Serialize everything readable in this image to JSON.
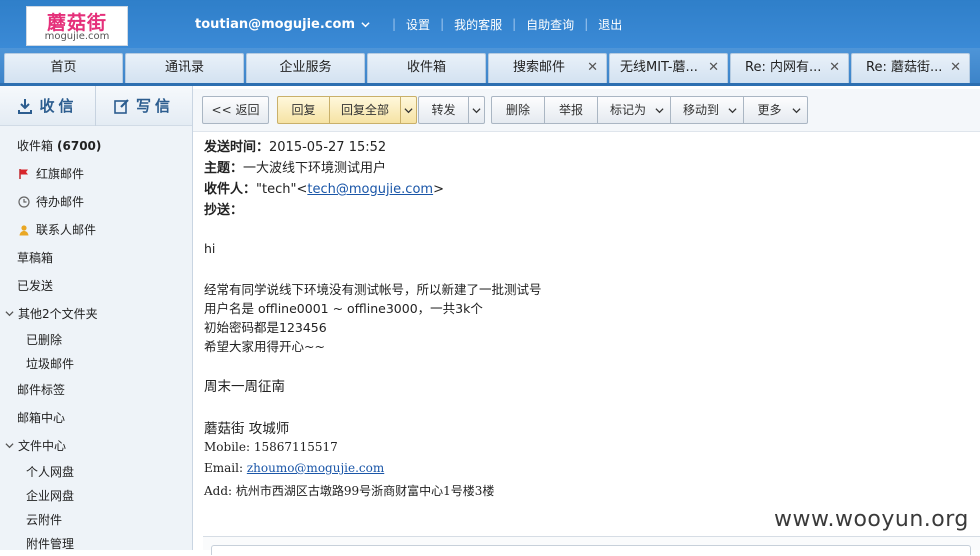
{
  "header": {
    "logo_text": "蘑菇街",
    "logo_sub": "mogujie.com",
    "user_email": "toutian@mogujie.com",
    "links": [
      "设置",
      "我的客服",
      "自助查询",
      "退出"
    ]
  },
  "tabs": [
    {
      "label": "首页"
    },
    {
      "label": "通讯录"
    },
    {
      "label": "企业服务"
    },
    {
      "label": "收件箱"
    },
    {
      "label": "搜索邮件"
    },
    {
      "label": "无线MIT-蘑..."
    },
    {
      "label": "Re: 内网有..."
    },
    {
      "label": "Re: 蘑菇街..."
    }
  ],
  "sidebar": {
    "receive_label": "收信",
    "write_label": "写信",
    "inbox_label": "收件箱",
    "inbox_count": "(6700)",
    "items": [
      {
        "label": "红旗邮件"
      },
      {
        "label": "待办邮件"
      },
      {
        "label": "联系人邮件"
      },
      {
        "label": "草稿箱"
      },
      {
        "label": "已发送"
      },
      {
        "label": "其他2个文件夹"
      },
      {
        "label": "已删除"
      },
      {
        "label": "垃圾邮件"
      },
      {
        "label": "邮件标签"
      },
      {
        "label": "邮箱中心"
      },
      {
        "label": "文件中心"
      },
      {
        "label": "个人网盘"
      },
      {
        "label": "企业网盘"
      },
      {
        "label": "云附件"
      },
      {
        "label": "附件管理"
      }
    ]
  },
  "toolbar": {
    "back": "返回",
    "reply": "回复",
    "reply_all": "回复全部",
    "forward": "转发",
    "delete": "删除",
    "report": "举报",
    "mark_as": "标记为",
    "move_to": "移动到",
    "more": "更多"
  },
  "mail": {
    "sent_label": "发送时间：",
    "sent_value": "2015-05-27 15:52",
    "subject_label": "主题：",
    "subject_value": "一大波线下环境测试用户",
    "to_label": "收件人：",
    "to_name": "\"tech\"<",
    "to_email": "tech@mogujie.com",
    "to_end": ">",
    "cc_label": "抄送：",
    "body": [
      "hi",
      "经常有同学说线下环境没有测试帐号，所以新建了一批测试号",
      "用户名是 offline0001 ~ offline3000，一共3k个",
      "初始密码都是123456",
      "希望大家用得开心~~"
    ],
    "signature": {
      "greeting": "周末一周征南",
      "company_title": "蘑菇街 攻城师",
      "mobile": "Mobile: 15867115517",
      "email_label": "Email: ",
      "email": "zhoumo@mogujie.com",
      "address": "Add: 杭州市西湖区古墩路99号浙商财富中心1号楼3楼"
    }
  },
  "watermark": "www.wooyun.org"
}
